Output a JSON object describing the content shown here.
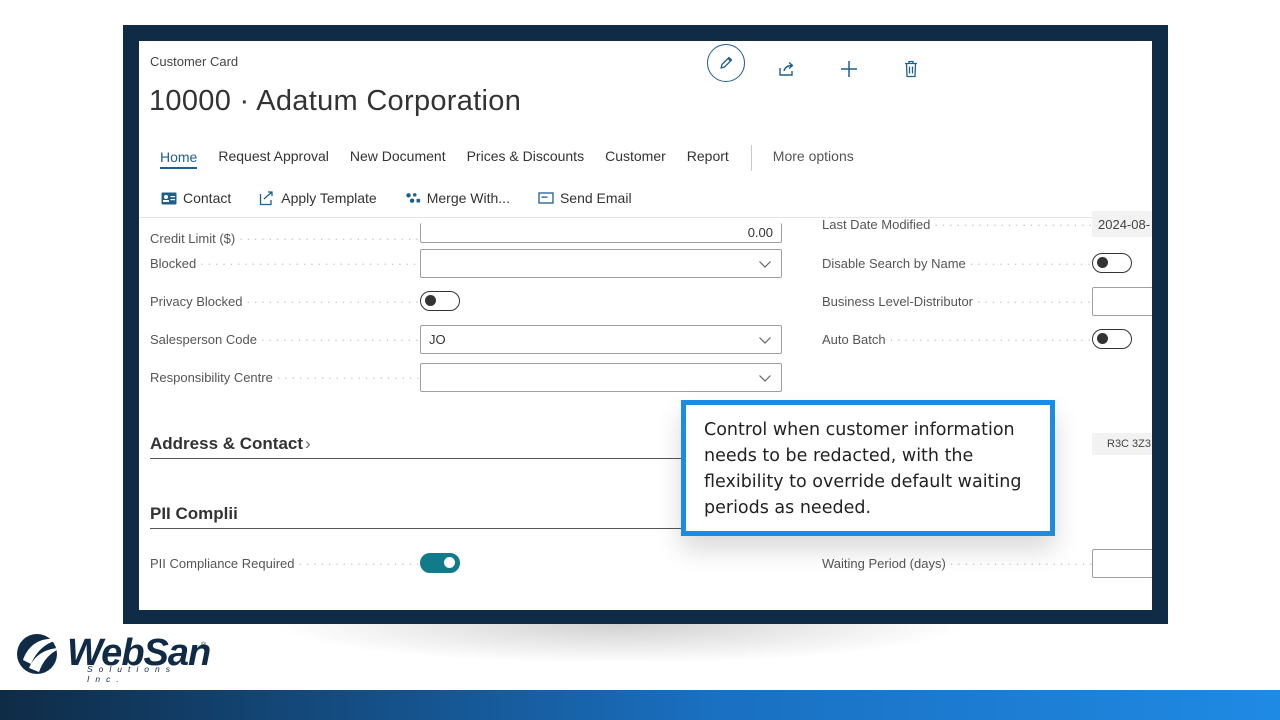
{
  "page": {
    "card_label": "Customer Card",
    "title": "10000 · Adatum Corporation"
  },
  "header_icons": [
    "edit-icon",
    "share-icon",
    "plus-icon",
    "delete-icon"
  ],
  "tabs": [
    {
      "label": "Home",
      "active": true
    },
    {
      "label": "Request Approval"
    },
    {
      "label": "New Document"
    },
    {
      "label": "Prices & Discounts"
    },
    {
      "label": "Customer"
    },
    {
      "label": "Report"
    },
    {
      "label": "More options"
    }
  ],
  "actions": [
    {
      "label": "Contact",
      "icon": "contact-card-icon"
    },
    {
      "label": "Apply Template",
      "icon": "template-icon"
    },
    {
      "label": "Merge With...",
      "icon": "merge-icon"
    },
    {
      "label": "Send Email",
      "icon": "email-icon"
    }
  ],
  "left_fields": {
    "credit_limit": {
      "label": "Credit Limit ($)",
      "value": "0.00"
    },
    "blocked": {
      "label": "Blocked",
      "value": ""
    },
    "privacy_blocked": {
      "label": "Privacy Blocked",
      "on": false
    },
    "salesperson_code": {
      "label": "Salesperson Code",
      "value": "JO"
    },
    "responsibility_centre": {
      "label": "Responsibility Centre",
      "value": ""
    }
  },
  "right_fields": {
    "last_date_modified": {
      "label": "Last Date Modified",
      "value": "2024-08-"
    },
    "disable_search": {
      "label": "Disable Search by Name",
      "on": false
    },
    "business_level": {
      "label": "Business Level-Distributor",
      "value": ""
    },
    "auto_batch": {
      "label": "Auto Batch",
      "on": false
    }
  },
  "sections": {
    "address_contact": "Address & Contact",
    "pii": "PII Complii"
  },
  "postal_code": "R3C 3Z3",
  "pii_fields": {
    "required": {
      "label": "PII Compliance Required",
      "on": true
    },
    "waiting_period": {
      "label": "Waiting Period (days)",
      "value": ""
    }
  },
  "callout": "Control when customer information needs to be redacted, with the flexibility to override default waiting periods as needed.",
  "logo": {
    "name": "WebSan",
    "sub": "Solutions Inc.",
    "reg": "®"
  },
  "colors": {
    "frame": "#0f2b46",
    "accent": "#1f5f8b",
    "toggle_on": "#117b8a",
    "callout_border": "#1a8ce6"
  }
}
